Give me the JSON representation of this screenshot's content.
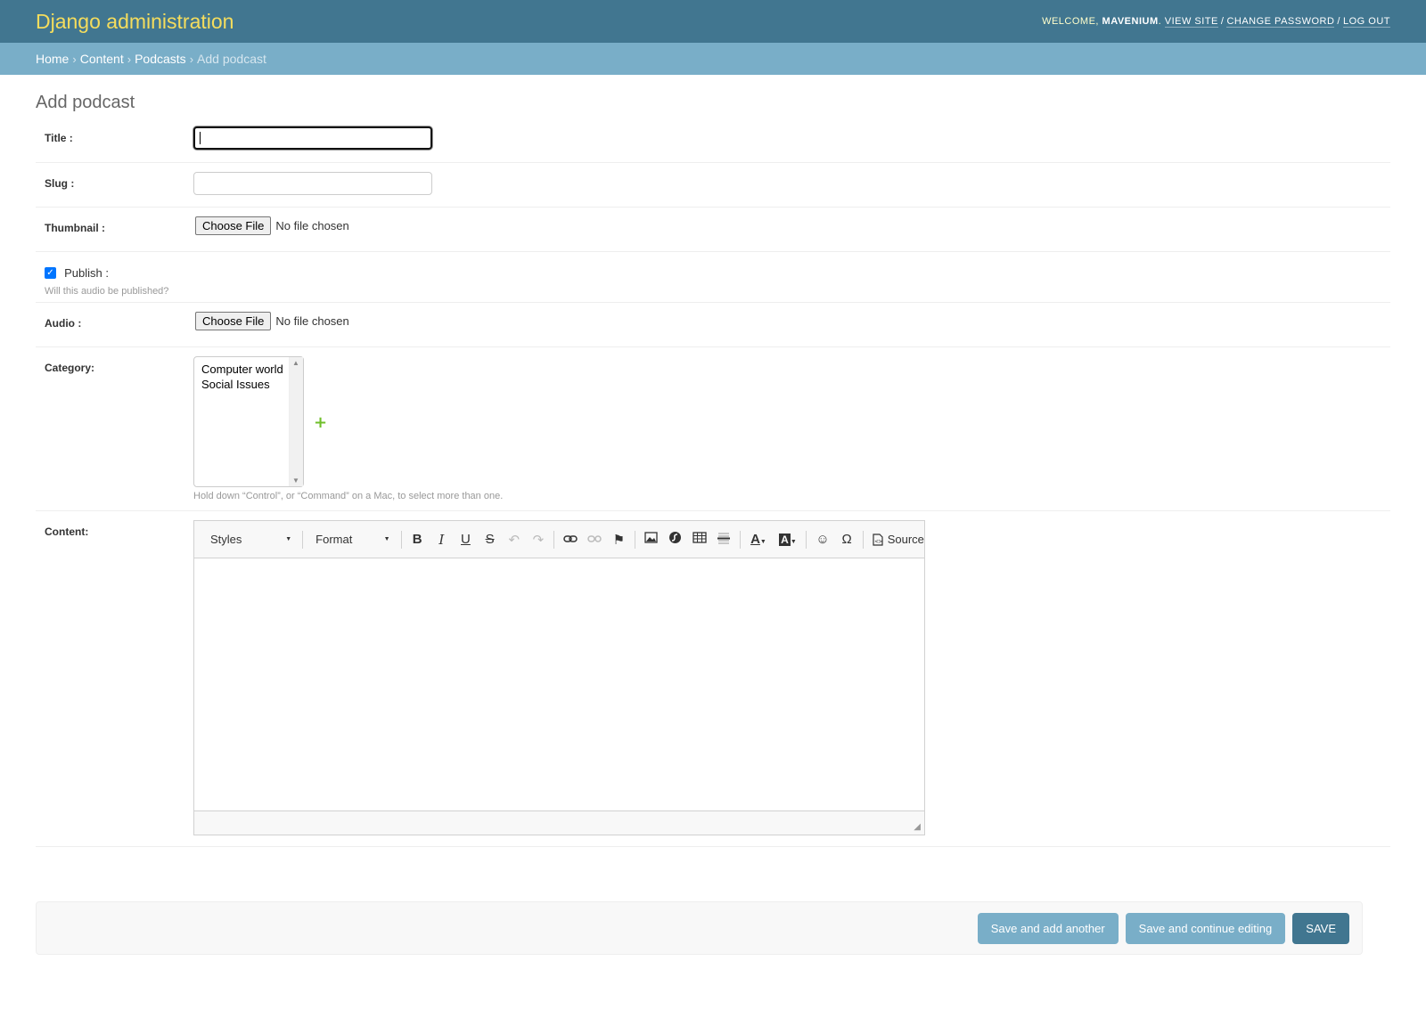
{
  "header": {
    "branding": "Django administration",
    "welcome": "WELCOME,",
    "username": "MAVENIUM",
    "view_site": "VIEW SITE",
    "change_password": "CHANGE PASSWORD",
    "log_out": "LOG OUT",
    "separator": "/"
  },
  "breadcrumbs": {
    "items": [
      "Home",
      "Content",
      "Podcasts"
    ],
    "current": "Add podcast",
    "separator": "›"
  },
  "page": {
    "title": "Add podcast"
  },
  "form": {
    "title_label": "Title :",
    "title_value": "",
    "slug_label": "Slug :",
    "slug_value": "",
    "thumbnail_label": "Thumbnail :",
    "thumbnail_button": "Choose File",
    "thumbnail_status": "No file chosen",
    "publish_label": "Publish :",
    "publish_checked": true,
    "publish_help": "Will this audio be published?",
    "audio_label": "Audio :",
    "audio_button": "Choose File",
    "audio_status": "No file chosen",
    "category_label": "Category:",
    "category_options": [
      "Computer world",
      "Social Issues"
    ],
    "category_help": "Hold down “Control”, or “Command” on a Mac, to select more than one.",
    "content_label": "Content:"
  },
  "editor": {
    "styles_label": "Styles",
    "format_label": "Format",
    "source_label": "Source",
    "icons": [
      "bold-icon",
      "italic-icon",
      "underline-icon",
      "strike-icon",
      "undo-icon",
      "redo-icon",
      "link-icon",
      "unlink-icon",
      "anchor-icon",
      "image-icon",
      "flash-icon",
      "table-icon",
      "horizontal-rule-icon",
      "text-color-icon",
      "bg-color-icon",
      "smiley-icon",
      "special-char-icon",
      "source-icon"
    ]
  },
  "actions": {
    "save_add_another": "Save and add another",
    "save_continue": "Save and continue editing",
    "save": "SAVE"
  },
  "colors": {
    "header_bg": "#417690",
    "breadcrumb_bg": "#79aec8",
    "branding": "#f5dd5d",
    "add_icon": "#70bf2b"
  }
}
